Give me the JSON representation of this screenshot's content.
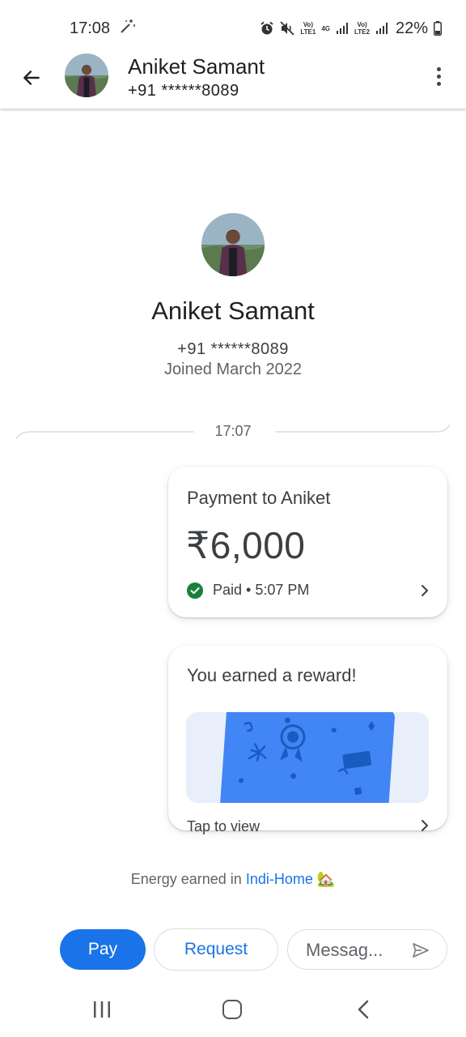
{
  "status_bar": {
    "time": "17:08",
    "battery": "22%",
    "sim1_tag": "Vo)\nLTE1",
    "net_tag": "4G",
    "sim2_tag": "Vo)\nLTE2"
  },
  "header": {
    "name": "Aniket Samant",
    "phone": "+91 ******8089"
  },
  "profile": {
    "name": "Aniket Samant",
    "phone": "+91 ******8089",
    "joined": "Joined March 2022"
  },
  "conversation": {
    "divider_time": "17:07",
    "payment": {
      "title": "Payment to Aniket",
      "amount": "₹6,000",
      "status": "Paid • 5:07 PM"
    },
    "reward": {
      "title": "You earned a reward!",
      "cta": "Tap to view"
    },
    "energy": {
      "prefix": "Energy earned in ",
      "link": "Indi-Home",
      "emoji": "🏡"
    }
  },
  "actions": {
    "pay": "Pay",
    "request": "Request",
    "message_placeholder": "Messag..."
  },
  "colors": {
    "accent": "#1a73e8",
    "success": "#188038",
    "reward_card": "#4285f4"
  }
}
